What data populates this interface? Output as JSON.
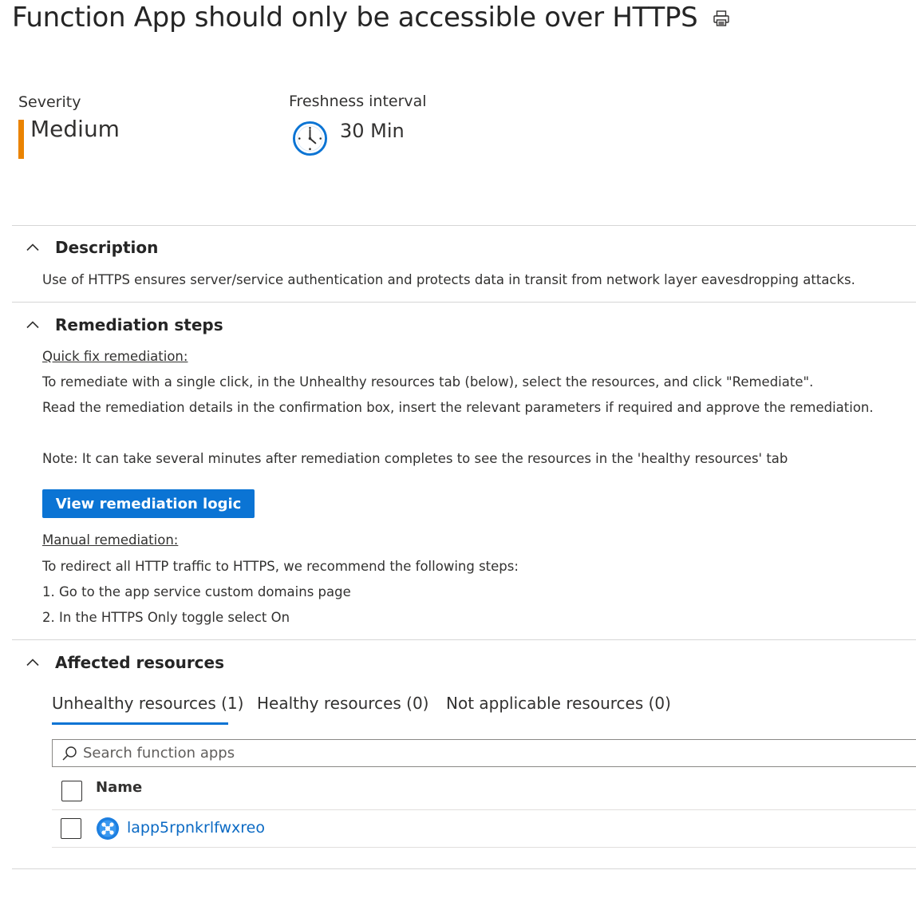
{
  "page": {
    "title": "Function App should only be accessible over HTTPS",
    "print_icon": "print-icon"
  },
  "severity": {
    "label": "Severity",
    "value": "Medium",
    "color": "#ea8300"
  },
  "freshness": {
    "label": "Freshness interval",
    "value": "30 Min",
    "icon": "clock-icon"
  },
  "description": {
    "heading": "Description",
    "text": "Use of HTTPS ensures server/service authentication and protects data in transit from network layer eavesdropping attacks."
  },
  "remediation": {
    "heading": "Remediation steps",
    "quick_fix_title": "Quick fix remediation:",
    "quick_fix_line1": "To remediate with a single click, in the Unhealthy resources tab (below), select the resources, and click \"Remediate\".",
    "quick_fix_line2": "Read the remediation details in the confirmation box, insert the relevant parameters if required and approve the remediation.",
    "note": "Note: It can take several minutes after remediation completes to see the resources in the 'healthy resources' tab",
    "button_label": "View remediation logic",
    "manual_title": "Manual remediation:",
    "manual_intro": "To redirect all HTTP traffic to HTTPS, we recommend the following steps:",
    "steps": [
      "1. Go to the app service custom domains page",
      "2. In the HTTPS Only toggle select On"
    ]
  },
  "affected": {
    "heading": "Affected resources",
    "tabs": [
      {
        "label": "Unhealthy resources (1)",
        "active": true
      },
      {
        "label": "Healthy resources (0)",
        "active": false
      },
      {
        "label": "Not applicable resources (0)",
        "active": false
      }
    ],
    "search_placeholder": "Search function apps",
    "column_name": "Name",
    "rows": [
      {
        "name": "lapp5rpnkrlfwxreo",
        "icon": "function-app-icon"
      }
    ]
  },
  "colors": {
    "accent": "#0b74d4",
    "link": "#0b6ac4"
  }
}
